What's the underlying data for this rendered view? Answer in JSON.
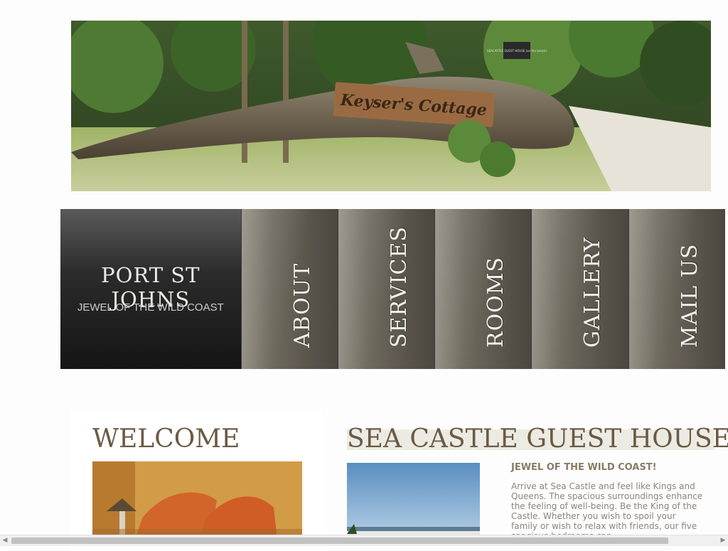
{
  "header": {
    "sign_text": "Keyser's Cottage",
    "small_sign_text": "SEACASTLE GUEST HOUSE (on the beach)"
  },
  "nav": {
    "brand_title": "PORT ST JOHNS",
    "brand_tagline": "JEWEL OF THE WILD COAST",
    "items": [
      {
        "label": "ABOUT"
      },
      {
        "label": "SERVICES"
      },
      {
        "label": "ROOMS"
      },
      {
        "label": "GALLERY"
      },
      {
        "label": "MAIL US"
      }
    ]
  },
  "welcome": {
    "title": "WELCOME"
  },
  "guesthouse": {
    "title": "SEA CASTLE GUEST HOUSE",
    "subheading": "JEWEL OF THE WILD COAST!",
    "body": "Arrive at Sea Castle and feel like Kings and Queens. The spacious surroundings enhance the feeling of well-being. Be the King of the Castle. Whether you wish to spoil your family or wish to relax with friends, our five spacious bedrooms can"
  },
  "colors": {
    "heading": "#6b5a45",
    "nav_tile": "#5a554b",
    "brand_bg": "#1a1a1a"
  },
  "scrollbar": {
    "left_icon": "◀",
    "right_icon": "▶"
  }
}
